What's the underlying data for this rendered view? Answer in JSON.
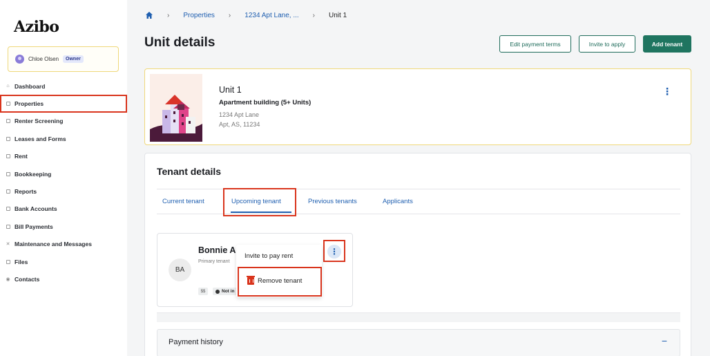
{
  "sidebar": {
    "logo": "Azibo",
    "user": {
      "name": "Chloe Olsen",
      "role": "Owner"
    },
    "items": [
      {
        "label": "Dashboard",
        "icon": "home-icon"
      },
      {
        "label": "Properties",
        "icon": "building-icon"
      },
      {
        "label": "Renter Screening",
        "icon": "screening-icon"
      },
      {
        "label": "Leases and Forms",
        "icon": "document-icon"
      },
      {
        "label": "Rent",
        "icon": "rent-icon"
      },
      {
        "label": "Bookkeeping",
        "icon": "book-icon"
      },
      {
        "label": "Reports",
        "icon": "report-icon"
      },
      {
        "label": "Bank Accounts",
        "icon": "bank-icon"
      },
      {
        "label": "Bill Payments",
        "icon": "bill-icon"
      },
      {
        "label": "Maintenance and Messages",
        "icon": "tools-icon"
      },
      {
        "label": "Files",
        "icon": "folder-icon"
      },
      {
        "label": "Contacts",
        "icon": "contacts-icon"
      }
    ]
  },
  "breadcrumb": {
    "properties": "Properties",
    "address": "1234 Apt Lane, ...",
    "unit": "Unit 1"
  },
  "page": {
    "title": "Unit details"
  },
  "actions": {
    "edit_terms": "Edit payment terms",
    "invite": "Invite to apply",
    "add_tenant": "Add tenant"
  },
  "unit": {
    "title": "Unit 1",
    "type": "Apartment building (5+ Units)",
    "address_line1": "1234 Apt Lane",
    "address_line2": "Apt, AS, 11234"
  },
  "tenant_details": {
    "heading": "Tenant details",
    "tabs": [
      "Current tenant",
      "Upcoming tenant",
      "Previous tenants",
      "Applicants"
    ],
    "tenant": {
      "name": "Bonnie Ac",
      "initials": "BA",
      "role": "Primary tenant",
      "chip_a": "$$",
      "chip_b": "Not in"
    },
    "menu": {
      "invite_rent": "Invite to pay rent",
      "remove": "Remove tenant"
    },
    "payment_history": "Payment history",
    "collapse_symbol": "−"
  },
  "colors": {
    "accent": "#1f7560",
    "link": "#1f5fb0",
    "highlight": "#d9341c",
    "card_border": "#efd87a"
  }
}
